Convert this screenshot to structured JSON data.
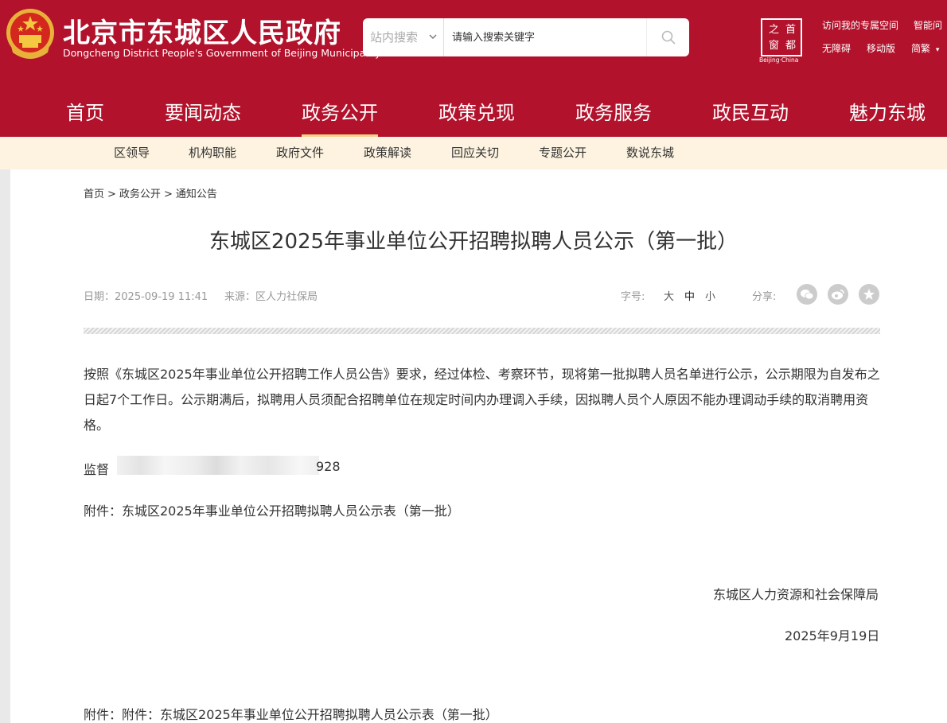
{
  "header": {
    "title": "北京市东城区人民政府",
    "subtitle": "Dongcheng District People's Government of Beijing Municipality",
    "search": {
      "scope": "站内搜索",
      "placeholder": "请输入搜索关键字"
    },
    "capital_logo": {
      "chars": [
        "之",
        "首",
        "窗",
        "都"
      ],
      "sub": "Beijing·China"
    },
    "links": {
      "personal_space": "访问我的专属空间",
      "smart": "智能问",
      "accessible": "无障碍",
      "mobile": "移动版",
      "simplified": "简繁",
      "simplified_caret": "▾"
    },
    "brand_color": "#b2122b"
  },
  "main_nav": [
    "首页",
    "要闻动态",
    "政务公开",
    "政策兑现",
    "政务服务",
    "政民互动",
    "魅力东城"
  ],
  "main_nav_active": "政务公开",
  "sub_nav": [
    "区领导",
    "机构职能",
    "政府文件",
    "政策解读",
    "回应关切",
    "专题公开",
    "数说东城"
  ],
  "breadcrumb": [
    "首页",
    "政务公开",
    "通知公告"
  ],
  "breadcrumb_sep": ">",
  "article": {
    "title": "东城区2025年事业单位公开招聘拟聘人员公示（第一批）",
    "date": "日期：2025-09-19 11:41",
    "source": "来源：区人力社保局",
    "font_label": "字号:",
    "font_sizes": [
      "大",
      "中",
      "小"
    ],
    "share_label": "分享:",
    "share_icons": [
      "wechat-icon",
      "weibo-icon",
      "favorite-star-icon"
    ],
    "body_lines": [
      "按照《东城区2025年事业单位公开招聘工作人员公告》要求，经过体检、考察环节，现将第一批拟聘人员名单进行公示，公示期限为自发布之",
      "日起7个工作日。公示期满后，拟聘用人员须配合招聘单位在规定时间内办理调入手续，因拟聘人员个人原因不能办理调动手续的取消聘用资",
      "格。"
    ],
    "supervise_prefix": "监督",
    "supervise_suffix": "928",
    "attachment": "附件：东城区2025年事业单位公开招聘拟聘人员公示表（第一批）",
    "signature": "东城区人力资源和社会保障局",
    "sign_date": "2025年9月19日",
    "attachment_bottom_label": "附件：",
    "attachment_bottom_link": "附件：东城区2025年事业单位公开招聘拟聘人员公示表（第一批）"
  }
}
